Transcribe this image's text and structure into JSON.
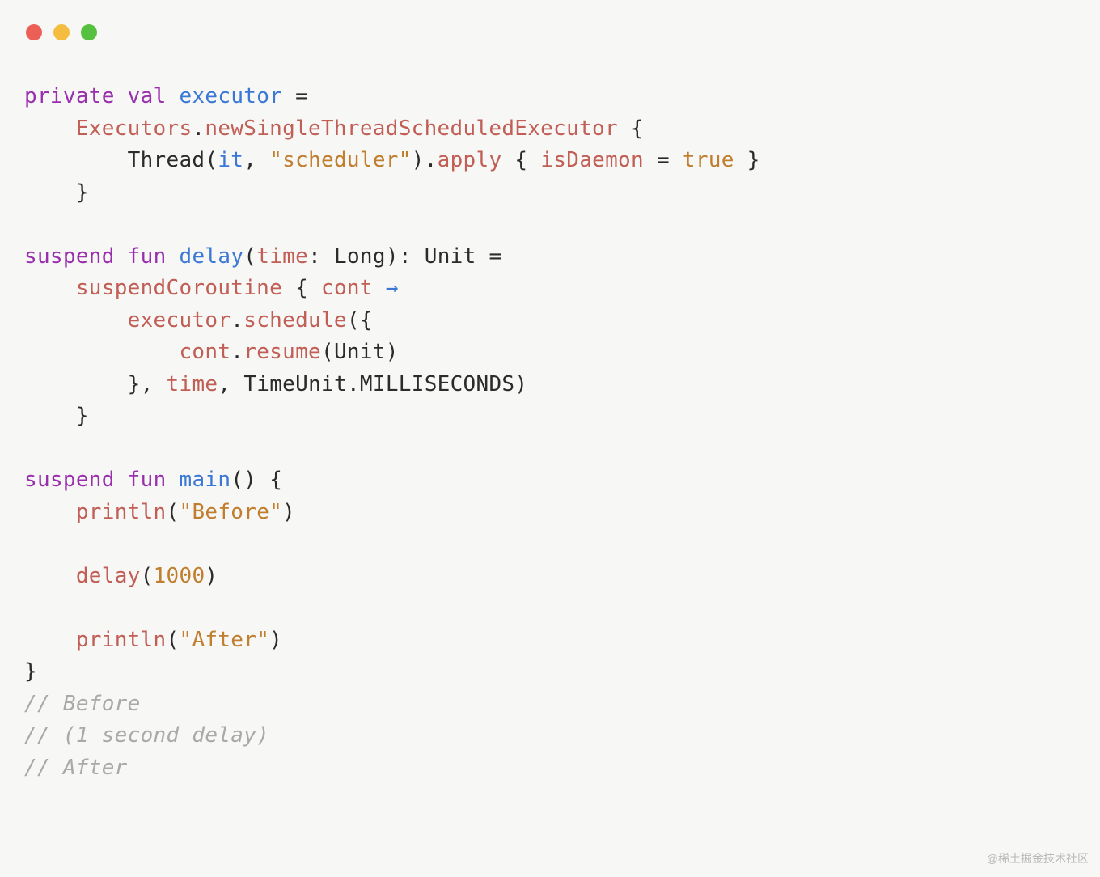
{
  "window": {
    "dots": [
      "red",
      "yellow",
      "green"
    ]
  },
  "watermark": "@稀土掘金技术社区",
  "code": {
    "t": {
      "private": "private",
      "val": "val",
      "executor": "executor",
      "eq": "=",
      "Executors": "Executors",
      "dot": ".",
      "newSingleThreadScheduledExecutor": "newSingleThreadScheduledExecutor",
      "lbrace": "{",
      "rbrace": "}",
      "Thread": "Thread",
      "lparen": "(",
      "rparen": ")",
      "it": "it",
      "comma": ",",
      "scheduler": "\"scheduler\"",
      "apply": "apply",
      "isDaemon": "isDaemon",
      "true": "true",
      "suspend": "suspend",
      "fun": "fun",
      "delay": "delay",
      "time": "time",
      "colon": ":",
      "Long": "Long",
      "Unit": "Unit",
      "suspendCoroutine": "suspendCoroutine",
      "cont": "cont",
      "arrow": "→",
      "schedule": "schedule",
      "resume": "resume",
      "TimeUnit": "TimeUnit",
      "MILLISECONDS": "MILLISECONDS",
      "main": "main",
      "println": "println",
      "before": "\"Before\"",
      "after": "\"After\"",
      "n1000": "1000",
      "c1": "// Before",
      "c2": "// (1 second delay)",
      "c3": "// After"
    }
  }
}
